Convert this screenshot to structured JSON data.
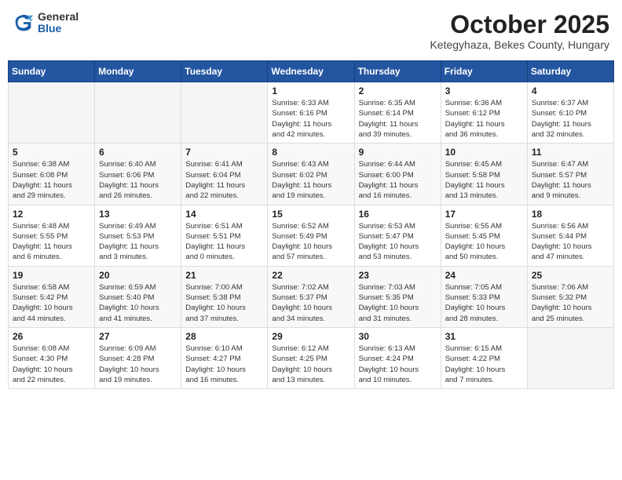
{
  "logo": {
    "general": "General",
    "blue": "Blue"
  },
  "title": {
    "month": "October 2025",
    "location": "Ketegyhaza, Bekes County, Hungary"
  },
  "weekdays": [
    "Sunday",
    "Monday",
    "Tuesday",
    "Wednesday",
    "Thursday",
    "Friday",
    "Saturday"
  ],
  "weeks": [
    [
      {
        "day": "",
        "info": ""
      },
      {
        "day": "",
        "info": ""
      },
      {
        "day": "",
        "info": ""
      },
      {
        "day": "1",
        "info": "Sunrise: 6:33 AM\nSunset: 6:16 PM\nDaylight: 11 hours\nand 42 minutes."
      },
      {
        "day": "2",
        "info": "Sunrise: 6:35 AM\nSunset: 6:14 PM\nDaylight: 11 hours\nand 39 minutes."
      },
      {
        "day": "3",
        "info": "Sunrise: 6:36 AM\nSunset: 6:12 PM\nDaylight: 11 hours\nand 36 minutes."
      },
      {
        "day": "4",
        "info": "Sunrise: 6:37 AM\nSunset: 6:10 PM\nDaylight: 11 hours\nand 32 minutes."
      }
    ],
    [
      {
        "day": "5",
        "info": "Sunrise: 6:38 AM\nSunset: 6:08 PM\nDaylight: 11 hours\nand 29 minutes."
      },
      {
        "day": "6",
        "info": "Sunrise: 6:40 AM\nSunset: 6:06 PM\nDaylight: 11 hours\nand 26 minutes."
      },
      {
        "day": "7",
        "info": "Sunrise: 6:41 AM\nSunset: 6:04 PM\nDaylight: 11 hours\nand 22 minutes."
      },
      {
        "day": "8",
        "info": "Sunrise: 6:43 AM\nSunset: 6:02 PM\nDaylight: 11 hours\nand 19 minutes."
      },
      {
        "day": "9",
        "info": "Sunrise: 6:44 AM\nSunset: 6:00 PM\nDaylight: 11 hours\nand 16 minutes."
      },
      {
        "day": "10",
        "info": "Sunrise: 6:45 AM\nSunset: 5:58 PM\nDaylight: 11 hours\nand 13 minutes."
      },
      {
        "day": "11",
        "info": "Sunrise: 6:47 AM\nSunset: 5:57 PM\nDaylight: 11 hours\nand 9 minutes."
      }
    ],
    [
      {
        "day": "12",
        "info": "Sunrise: 6:48 AM\nSunset: 5:55 PM\nDaylight: 11 hours\nand 6 minutes."
      },
      {
        "day": "13",
        "info": "Sunrise: 6:49 AM\nSunset: 5:53 PM\nDaylight: 11 hours\nand 3 minutes."
      },
      {
        "day": "14",
        "info": "Sunrise: 6:51 AM\nSunset: 5:51 PM\nDaylight: 11 hours\nand 0 minutes."
      },
      {
        "day": "15",
        "info": "Sunrise: 6:52 AM\nSunset: 5:49 PM\nDaylight: 10 hours\nand 57 minutes."
      },
      {
        "day": "16",
        "info": "Sunrise: 6:53 AM\nSunset: 5:47 PM\nDaylight: 10 hours\nand 53 minutes."
      },
      {
        "day": "17",
        "info": "Sunrise: 6:55 AM\nSunset: 5:45 PM\nDaylight: 10 hours\nand 50 minutes."
      },
      {
        "day": "18",
        "info": "Sunrise: 6:56 AM\nSunset: 5:44 PM\nDaylight: 10 hours\nand 47 minutes."
      }
    ],
    [
      {
        "day": "19",
        "info": "Sunrise: 6:58 AM\nSunset: 5:42 PM\nDaylight: 10 hours\nand 44 minutes."
      },
      {
        "day": "20",
        "info": "Sunrise: 6:59 AM\nSunset: 5:40 PM\nDaylight: 10 hours\nand 41 minutes."
      },
      {
        "day": "21",
        "info": "Sunrise: 7:00 AM\nSunset: 5:38 PM\nDaylight: 10 hours\nand 37 minutes."
      },
      {
        "day": "22",
        "info": "Sunrise: 7:02 AM\nSunset: 5:37 PM\nDaylight: 10 hours\nand 34 minutes."
      },
      {
        "day": "23",
        "info": "Sunrise: 7:03 AM\nSunset: 5:35 PM\nDaylight: 10 hours\nand 31 minutes."
      },
      {
        "day": "24",
        "info": "Sunrise: 7:05 AM\nSunset: 5:33 PM\nDaylight: 10 hours\nand 28 minutes."
      },
      {
        "day": "25",
        "info": "Sunrise: 7:06 AM\nSunset: 5:32 PM\nDaylight: 10 hours\nand 25 minutes."
      }
    ],
    [
      {
        "day": "26",
        "info": "Sunrise: 6:08 AM\nSunset: 4:30 PM\nDaylight: 10 hours\nand 22 minutes."
      },
      {
        "day": "27",
        "info": "Sunrise: 6:09 AM\nSunset: 4:28 PM\nDaylight: 10 hours\nand 19 minutes."
      },
      {
        "day": "28",
        "info": "Sunrise: 6:10 AM\nSunset: 4:27 PM\nDaylight: 10 hours\nand 16 minutes."
      },
      {
        "day": "29",
        "info": "Sunrise: 6:12 AM\nSunset: 4:25 PM\nDaylight: 10 hours\nand 13 minutes."
      },
      {
        "day": "30",
        "info": "Sunrise: 6:13 AM\nSunset: 4:24 PM\nDaylight: 10 hours\nand 10 minutes."
      },
      {
        "day": "31",
        "info": "Sunrise: 6:15 AM\nSunset: 4:22 PM\nDaylight: 10 hours\nand 7 minutes."
      },
      {
        "day": "",
        "info": ""
      }
    ]
  ]
}
